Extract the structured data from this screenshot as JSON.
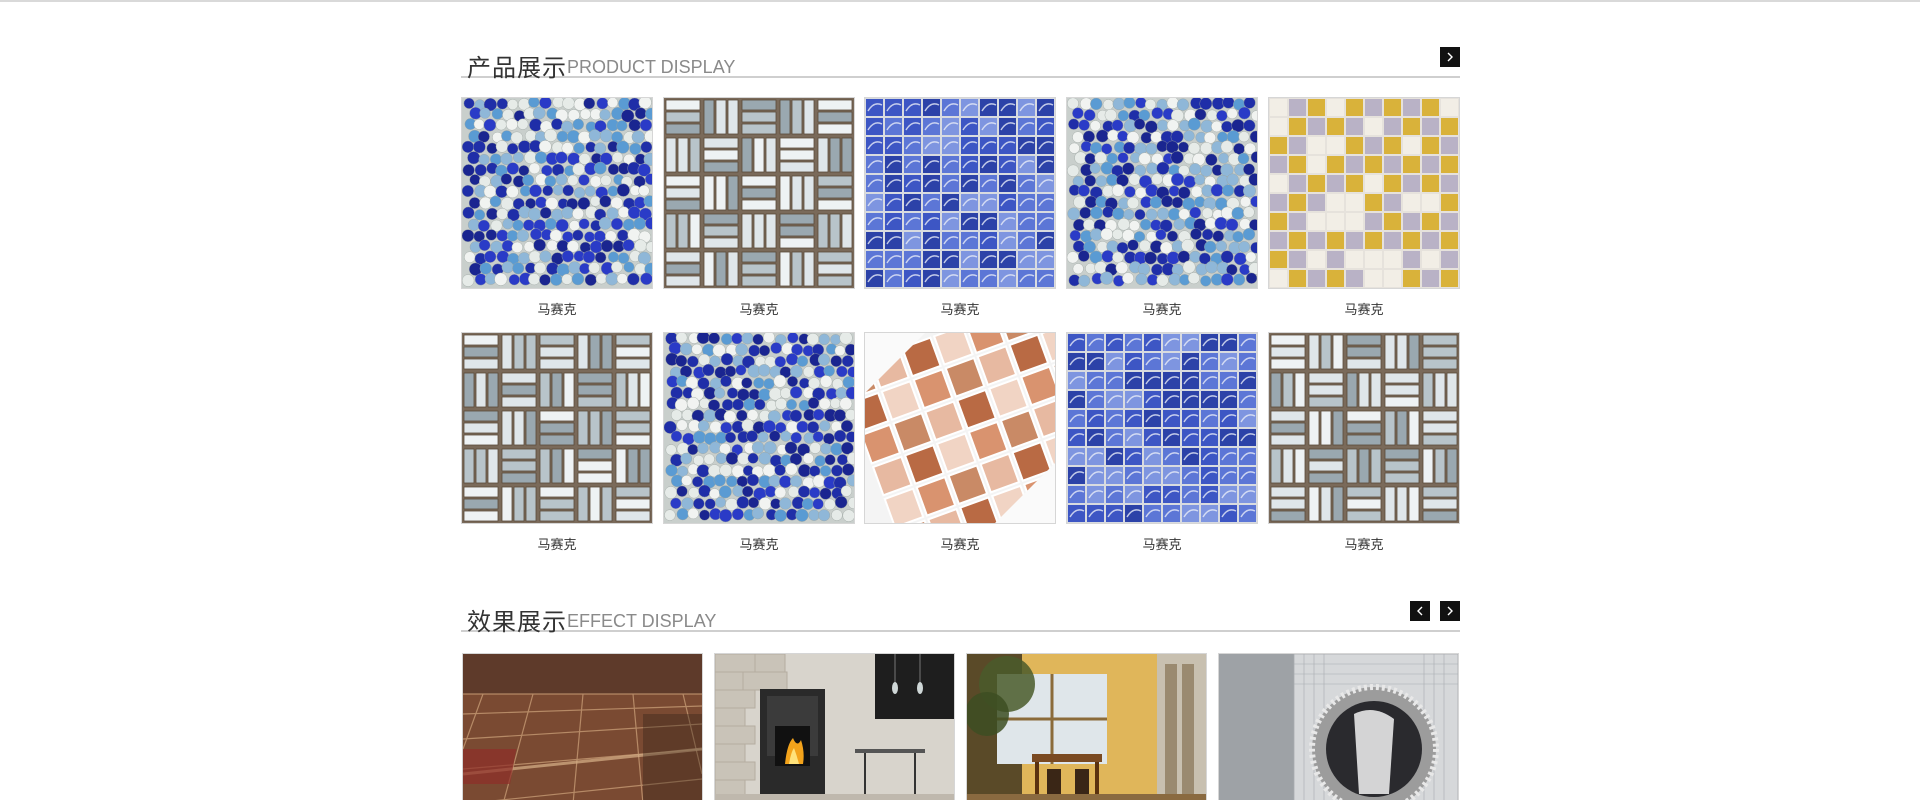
{
  "product_section": {
    "title_cn": "产品展示",
    "title_en": "PRODUCT DISPLAY",
    "next_icon": "chevron-right-icon",
    "rows": [
      [
        {
          "caption": "马赛克",
          "pattern": "beads"
        },
        {
          "caption": "马赛克",
          "pattern": "weave"
        },
        {
          "caption": "马赛克",
          "pattern": "blue-tiles"
        },
        {
          "caption": "马赛克",
          "pattern": "beads"
        },
        {
          "caption": "马赛克",
          "pattern": "gold-checker"
        }
      ],
      [
        {
          "caption": "马赛克",
          "pattern": "weave"
        },
        {
          "caption": "马赛克",
          "pattern": "beads"
        },
        {
          "caption": "马赛克",
          "pattern": "brown-squares"
        },
        {
          "caption": "马赛克",
          "pattern": "blue-tiles"
        },
        {
          "caption": "马赛克",
          "pattern": "weave"
        }
      ]
    ]
  },
  "effect_section": {
    "title_cn": "效果展示",
    "title_en": "EFFECT DISPLAY",
    "prev_icon": "chevron-left-icon",
    "next_icon": "chevron-right-icon",
    "images": [
      {
        "scene": "tiled-floor"
      },
      {
        "scene": "fireplace-room"
      },
      {
        "scene": "dining-room"
      },
      {
        "scene": "mosaic-mirror"
      }
    ]
  }
}
